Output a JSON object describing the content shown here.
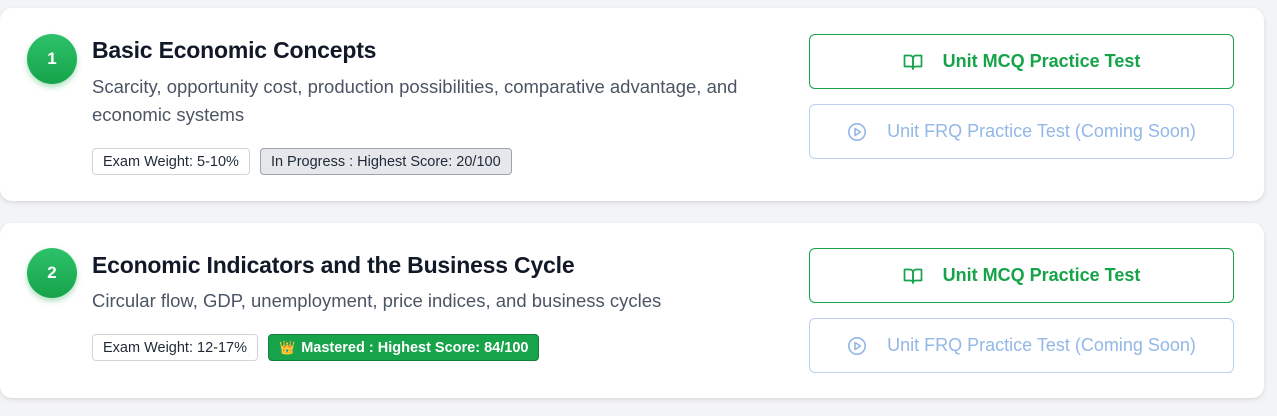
{
  "units": [
    {
      "number": "1",
      "title": "Basic Economic Concepts",
      "description": "Scarcity, opportunity cost, production possibilities, comparative advantage, and economic systems",
      "exam_weight": "Exam Weight: 5-10%",
      "status": "In Progress : Highest Score: 20/100",
      "mcq_label": "Unit MCQ Practice Test",
      "frq_label": "Unit FRQ Practice Test (Coming Soon)"
    },
    {
      "number": "2",
      "title": "Economic Indicators and the Business Cycle",
      "description": "Circular flow, GDP, unemployment, price indices, and business cycles",
      "exam_weight": "Exam Weight: 12-17%",
      "status": "Mastered : Highest Score: 84/100",
      "status_icon": "crown-icon",
      "mcq_label": "Unit MCQ Practice Test",
      "frq_label": "Unit FRQ Practice Test (Coming Soon)"
    }
  ],
  "colors": {
    "accent_green": "#16a34a",
    "frq_blue_muted": "#93b7e6",
    "progress_gray": "#e5e7eb"
  }
}
